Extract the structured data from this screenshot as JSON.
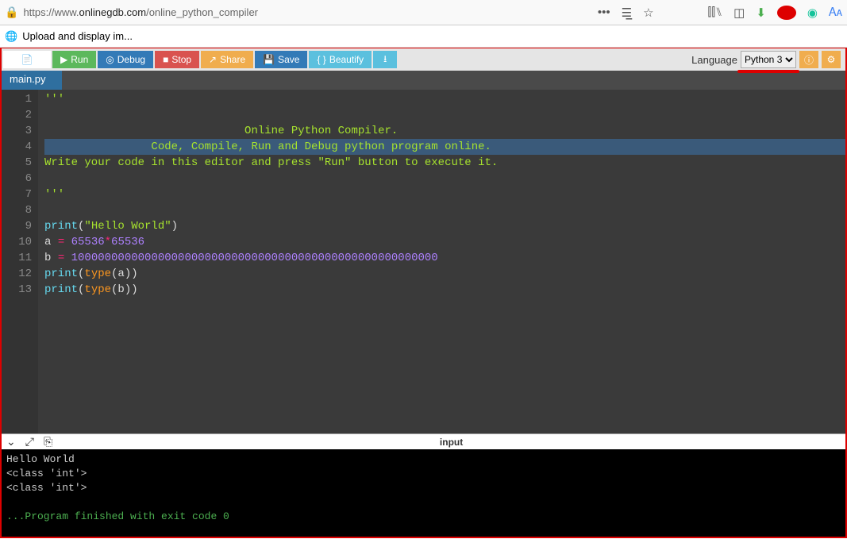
{
  "browser": {
    "url_prefix": "https://www.",
    "url_domain": "onlinegdb.com",
    "url_path": "/online_python_compiler",
    "tab_title": "Upload and display im..."
  },
  "toolbar": {
    "run": "Run",
    "debug": "Debug",
    "stop": "Stop",
    "share": "Share",
    "save": "Save",
    "beautify": "Beautify",
    "language_label": "Language",
    "language_value": "Python 3"
  },
  "editor": {
    "tab_name": "main.py",
    "lines": [
      {
        "n": 1,
        "segs": [
          {
            "t": "'''",
            "c": "str"
          }
        ]
      },
      {
        "n": 2,
        "segs": []
      },
      {
        "n": 3,
        "segs": [
          {
            "t": "                              Online Python Compiler.",
            "c": "str"
          }
        ]
      },
      {
        "n": 4,
        "segs": [
          {
            "t": "                Code, Compile, Run and Debug python program online.",
            "c": "str"
          }
        ],
        "selected": true
      },
      {
        "n": 5,
        "segs": [
          {
            "t": "Write your code in this editor and press \"Run\" button to execute it.",
            "c": "str"
          }
        ]
      },
      {
        "n": 6,
        "segs": []
      },
      {
        "n": 7,
        "segs": [
          {
            "t": "'''",
            "c": "str"
          }
        ]
      },
      {
        "n": 8,
        "segs": []
      },
      {
        "n": 9,
        "segs": [
          {
            "t": "print",
            "c": "kw"
          },
          {
            "t": "(",
            "c": ""
          },
          {
            "t": "\"Hello World\"",
            "c": "str"
          },
          {
            "t": ")",
            "c": ""
          }
        ]
      },
      {
        "n": 10,
        "segs": [
          {
            "t": "a ",
            "c": ""
          },
          {
            "t": "=",
            "c": "op"
          },
          {
            "t": " ",
            "c": ""
          },
          {
            "t": "65536",
            "c": "num"
          },
          {
            "t": "*",
            "c": "op"
          },
          {
            "t": "65536",
            "c": "num"
          }
        ]
      },
      {
        "n": 11,
        "segs": [
          {
            "t": "b ",
            "c": ""
          },
          {
            "t": "=",
            "c": "op"
          },
          {
            "t": " ",
            "c": ""
          },
          {
            "t": "1000000000000000000000000000000000000000000000000000000",
            "c": "num"
          }
        ]
      },
      {
        "n": 12,
        "segs": [
          {
            "t": "print",
            "c": "kw"
          },
          {
            "t": "(",
            "c": ""
          },
          {
            "t": "type",
            "c": "fn"
          },
          {
            "t": "(a))",
            "c": ""
          }
        ]
      },
      {
        "n": 13,
        "segs": [
          {
            "t": "print",
            "c": "kw"
          },
          {
            "t": "(",
            "c": ""
          },
          {
            "t": "type",
            "c": "fn"
          },
          {
            "t": "(b))",
            "c": ""
          }
        ]
      }
    ]
  },
  "console": {
    "input_label": "input",
    "output": [
      "Hello World",
      "<class 'int'>",
      "<class 'int'>"
    ],
    "exit_line": "...Program finished with exit code 0"
  }
}
